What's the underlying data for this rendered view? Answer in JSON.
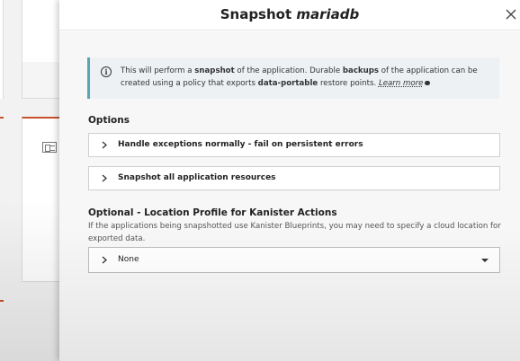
{
  "dialog": {
    "title_prefix": "Snapshot ",
    "app_name": "mariadb"
  },
  "info": {
    "t1": "This will perform a ",
    "b1": "snapshot",
    "t2": " of the application. Durable ",
    "b2": "backups",
    "t3": " of the application can be created using a policy that exports ",
    "b3": "data-portable",
    "t4": " restore points. ",
    "learn_more": "Learn more"
  },
  "options": {
    "heading": "Options",
    "items": [
      {
        "label": "Handle exceptions normally - fail on persistent errors"
      },
      {
        "label": "Snapshot all application resources"
      }
    ]
  },
  "location_profile": {
    "heading": "Optional - Location Profile for Kanister Actions",
    "help": "If the applications being snapshotted use Kanister Blueprints, you may need to specify a cloud location for exported data.",
    "selected": "None"
  },
  "colors": {
    "accent": "#c8512c",
    "info_border": "#5aa7b4"
  },
  "icons": [
    "close-icon",
    "info-icon",
    "chevron-right-icon",
    "caret-down-icon",
    "chat-bubble-icon"
  ]
}
